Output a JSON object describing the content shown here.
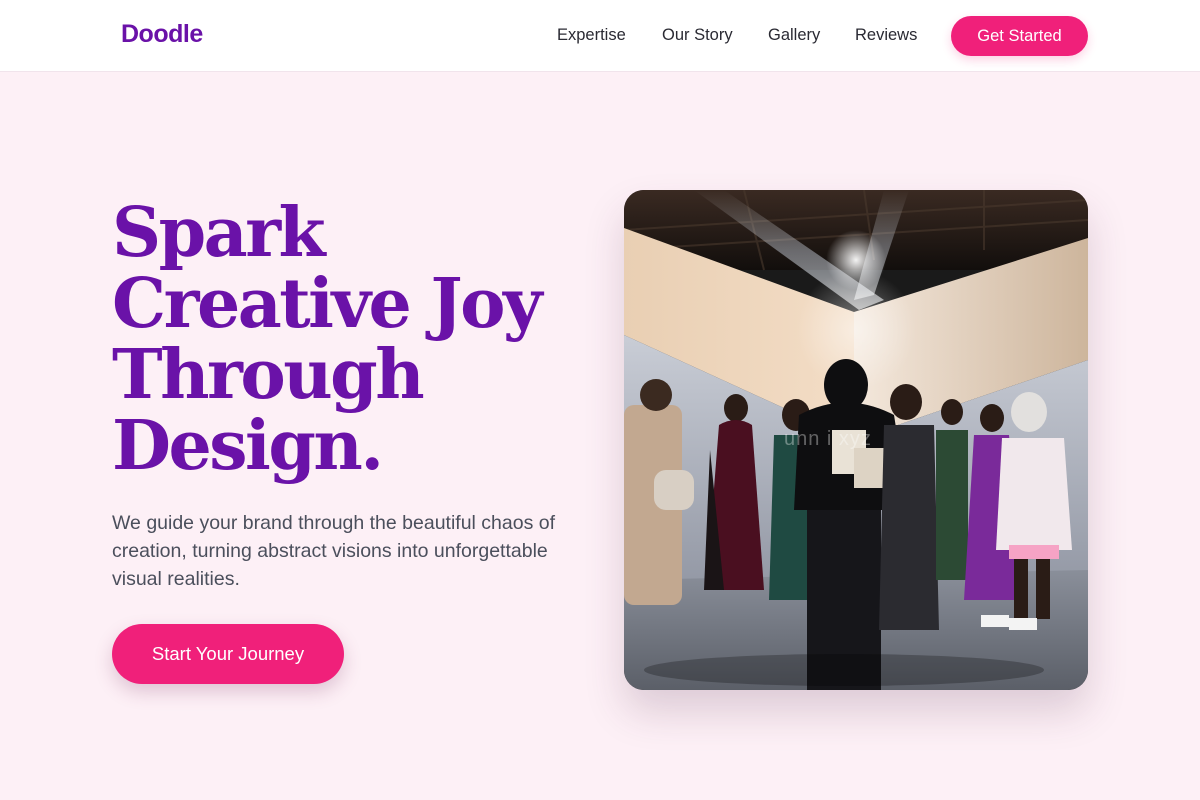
{
  "brand": {
    "name": "Doodle"
  },
  "nav": {
    "links": [
      "Expertise",
      "Our Story",
      "Gallery",
      "Reviews"
    ],
    "cta_label": "Get Started"
  },
  "hero": {
    "title_lines": [
      "Spark",
      "Creative Joy",
      "Through",
      "Design."
    ],
    "subtitle": "We guide your brand through the beautiful chaos of creation, turning abstract visions into unforgettable visual realities.",
    "cta_label": "Start Your Journey",
    "image_watermark": "unn      i xyz"
  },
  "colors": {
    "brand_purple": "#6a12a8",
    "accent_pink": "#f0207a",
    "page_background": "#fdf0f6"
  }
}
